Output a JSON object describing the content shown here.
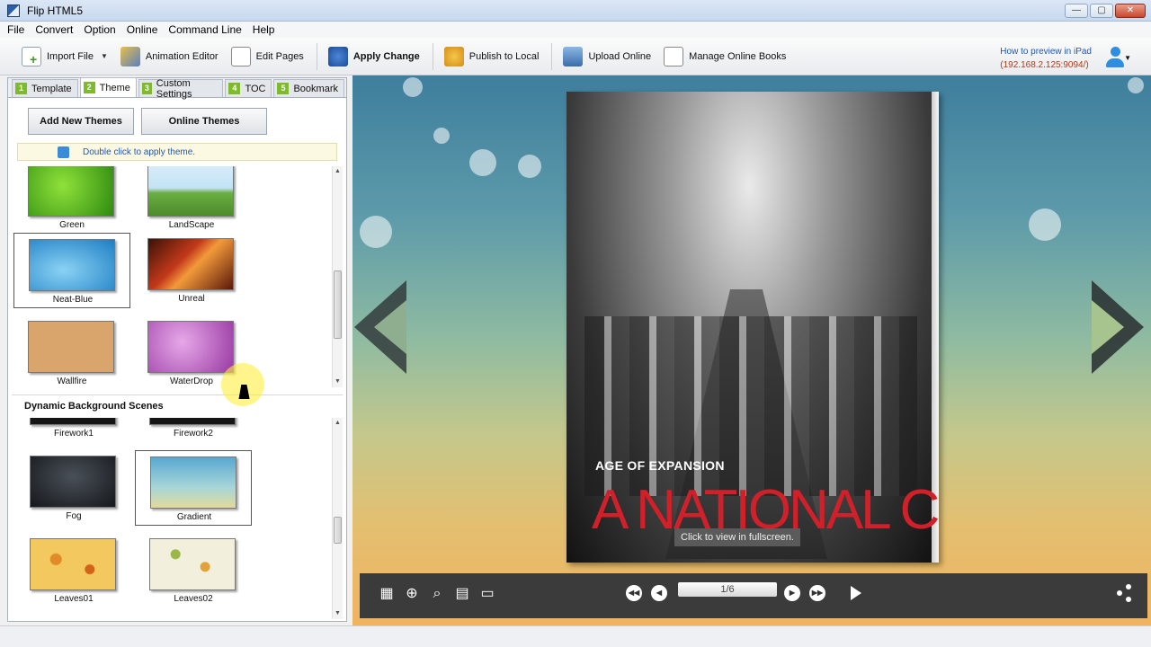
{
  "window": {
    "title": "Flip HTML5",
    "controls": [
      "—",
      "▢",
      "✕"
    ]
  },
  "menu": [
    "File",
    "Convert",
    "Option",
    "Online",
    "Command Line",
    "Help"
  ],
  "toolbar": {
    "import_file": "Import File",
    "animation_editor": "Animation Editor",
    "edit_pages": "Edit Pages",
    "apply_change": "Apply Change",
    "publish_local": "Publish to Local",
    "upload_online": "Upload Online",
    "manage_online": "Manage Online Books",
    "ipad_link": "How to preview in iPad",
    "ipad_ip": "(192.168.2.125:9094/)"
  },
  "tabs": [
    {
      "num": "1",
      "label": "Template"
    },
    {
      "num": "2",
      "label": "Theme"
    },
    {
      "num": "3",
      "label": "Custom Settings"
    },
    {
      "num": "4",
      "label": "TOC"
    },
    {
      "num": "5",
      "label": "Bookmark"
    }
  ],
  "buttons": {
    "add_new_themes": "Add New Themes",
    "online_themes": "Online Themes"
  },
  "hint": "Double click to apply theme.",
  "themes": [
    "Green",
    "LandScape",
    "Neat-Blue",
    "Unreal",
    "Wallfire",
    "WaterDrop"
  ],
  "dynamic_section_title": "Dynamic Background Scenes",
  "scenes": [
    "Firework1",
    "Firework2",
    "Fog",
    "Gradient",
    "Leaves01",
    "Leaves02"
  ],
  "book": {
    "subtitle": "AGE OF EXPANSION",
    "title": "A NATIONAL C",
    "overlay": "Click to view in fullscreen."
  },
  "pager": {
    "page": "1/6"
  }
}
